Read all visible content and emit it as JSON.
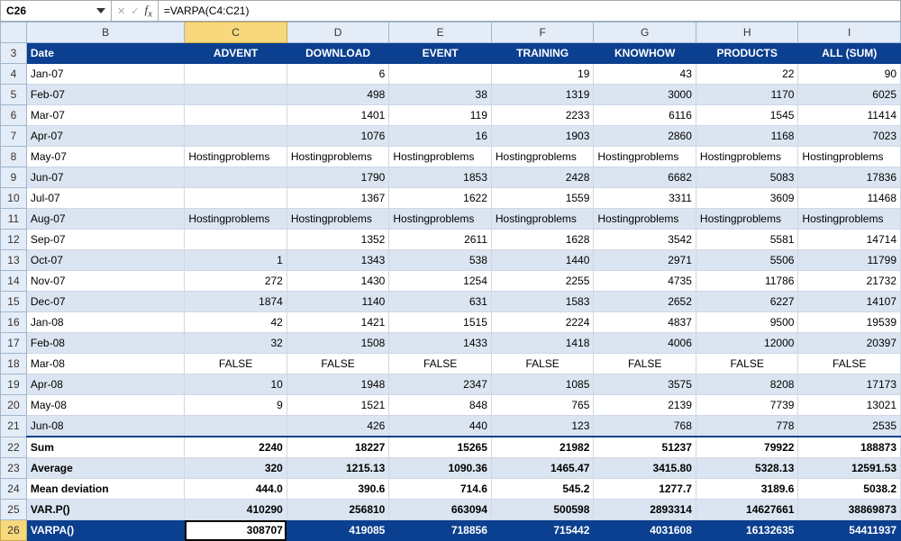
{
  "formula_bar": {
    "cell_ref": "C26",
    "formula": "=VARPA(C4:C21)"
  },
  "columns": [
    "B",
    "C",
    "D",
    "E",
    "F",
    "G",
    "H",
    "I"
  ],
  "row_numbers": [
    3,
    4,
    5,
    6,
    7,
    8,
    9,
    10,
    11,
    12,
    13,
    14,
    15,
    16,
    17,
    18,
    19,
    20,
    21,
    22,
    23,
    24,
    25,
    26
  ],
  "headers": [
    "Date",
    "ADVENT",
    "DOWNLOAD",
    "EVENT",
    "TRAINING",
    "KNOWHOW",
    "PRODUCTS",
    "ALL (SUM)"
  ],
  "data_rows": [
    {
      "date": "Jan-07",
      "vals": [
        "",
        "6",
        "",
        "19",
        "43",
        "22",
        "90"
      ]
    },
    {
      "date": "Feb-07",
      "vals": [
        "",
        "498",
        "38",
        "1319",
        "3000",
        "1170",
        "6025"
      ]
    },
    {
      "date": "Mar-07",
      "vals": [
        "",
        "1401",
        "119",
        "2233",
        "6116",
        "1545",
        "11414"
      ]
    },
    {
      "date": "Apr-07",
      "vals": [
        "",
        "1076",
        "16",
        "1903",
        "2860",
        "1168",
        "7023"
      ]
    },
    {
      "date": "May-07",
      "vals": [
        "Hostingproblems",
        "Hostingproblems",
        "Hostingproblems",
        "Hostingproblems",
        "Hostingproblems",
        "Hostingproblems",
        "Hostingproblems"
      ]
    },
    {
      "date": "Jun-07",
      "vals": [
        "",
        "1790",
        "1853",
        "2428",
        "6682",
        "5083",
        "17836"
      ]
    },
    {
      "date": "Jul-07",
      "vals": [
        "",
        "1367",
        "1622",
        "1559",
        "3311",
        "3609",
        "11468"
      ]
    },
    {
      "date": "Aug-07",
      "vals": [
        "Hostingproblems",
        "Hostingproblems",
        "Hostingproblems",
        "Hostingproblems",
        "Hostingproblems",
        "Hostingproblems",
        "Hostingproblems"
      ]
    },
    {
      "date": "Sep-07",
      "vals": [
        "",
        "1352",
        "2611",
        "1628",
        "3542",
        "5581",
        "14714"
      ]
    },
    {
      "date": "Oct-07",
      "vals": [
        "1",
        "1343",
        "538",
        "1440",
        "2971",
        "5506",
        "11799"
      ]
    },
    {
      "date": "Nov-07",
      "vals": [
        "272",
        "1430",
        "1254",
        "2255",
        "4735",
        "11786",
        "21732"
      ]
    },
    {
      "date": "Dec-07",
      "vals": [
        "1874",
        "1140",
        "631",
        "1583",
        "2652",
        "6227",
        "14107"
      ]
    },
    {
      "date": "Jan-08",
      "vals": [
        "42",
        "1421",
        "1515",
        "2224",
        "4837",
        "9500",
        "19539"
      ]
    },
    {
      "date": "Feb-08",
      "vals": [
        "32",
        "1508",
        "1433",
        "1418",
        "4006",
        "12000",
        "20397"
      ]
    },
    {
      "date": "Mar-08",
      "vals": [
        "FALSE",
        "FALSE",
        "FALSE",
        "FALSE",
        "FALSE",
        "FALSE",
        "FALSE"
      ]
    },
    {
      "date": "Apr-08",
      "vals": [
        "10",
        "1948",
        "2347",
        "1085",
        "3575",
        "8208",
        "17173"
      ]
    },
    {
      "date": "May-08",
      "vals": [
        "9",
        "1521",
        "848",
        "765",
        "2139",
        "7739",
        "13021"
      ]
    },
    {
      "date": "Jun-08",
      "vals": [
        "",
        "426",
        "440",
        "123",
        "768",
        "778",
        "2535"
      ]
    }
  ],
  "summary_rows": [
    {
      "label": "Sum",
      "vals": [
        "2240",
        "18227",
        "15265",
        "21982",
        "51237",
        "79922",
        "188873"
      ]
    },
    {
      "label": "Average",
      "vals": [
        "320",
        "1215.13",
        "1090.36",
        "1465.47",
        "3415.80",
        "5328.13",
        "12591.53"
      ]
    },
    {
      "label": "Mean deviation",
      "vals": [
        "444.0",
        "390.6",
        "714.6",
        "545.2",
        "1277.7",
        "3189.6",
        "5038.2"
      ]
    },
    {
      "label": "VAR.P()",
      "vals": [
        "410290",
        "256810",
        "663094",
        "500598",
        "2893314",
        "14627661",
        "38869873"
      ]
    },
    {
      "label": "VARPA()",
      "vals": [
        "308707",
        "419085",
        "718856",
        "715442",
        "4031608",
        "16132635",
        "54411937"
      ]
    }
  ],
  "active_cell": {
    "row": 26,
    "col": "C"
  },
  "chart_data": {
    "type": "table",
    "title": "",
    "categories": [
      "ADVENT",
      "DOWNLOAD",
      "EVENT",
      "TRAINING",
      "KNOWHOW",
      "PRODUCTS",
      "ALL (SUM)"
    ],
    "rows": [
      "Jan-07",
      "Feb-07",
      "Mar-07",
      "Apr-07",
      "May-07",
      "Jun-07",
      "Jul-07",
      "Aug-07",
      "Sep-07",
      "Oct-07",
      "Nov-07",
      "Dec-07",
      "Jan-08",
      "Feb-08",
      "Mar-08",
      "Apr-08",
      "May-08",
      "Jun-08"
    ],
    "stats": [
      "Sum",
      "Average",
      "Mean deviation",
      "VAR.P()",
      "VARPA()"
    ]
  }
}
